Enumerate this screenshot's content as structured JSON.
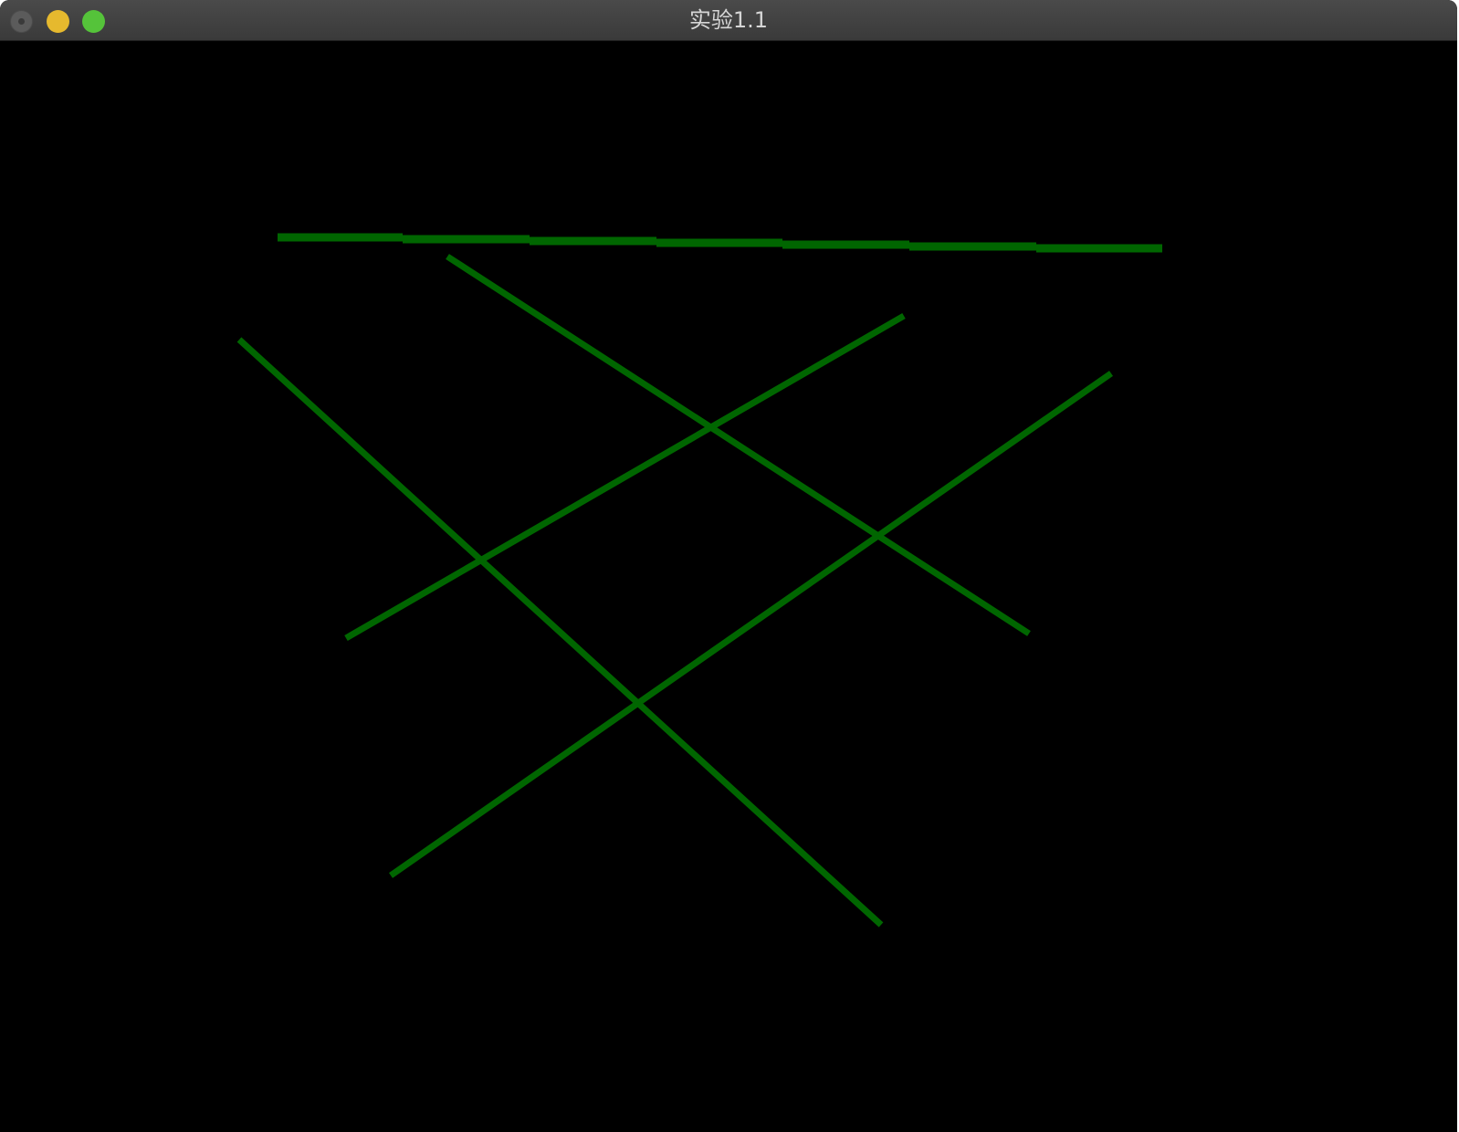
{
  "window": {
    "title": "实验1.1",
    "controls": {
      "close": "close-button",
      "minimize": "minimize-button",
      "zoom": "zoom-button"
    }
  },
  "canvas": {
    "background_color": "#000000",
    "line_color": "#006600"
  }
}
